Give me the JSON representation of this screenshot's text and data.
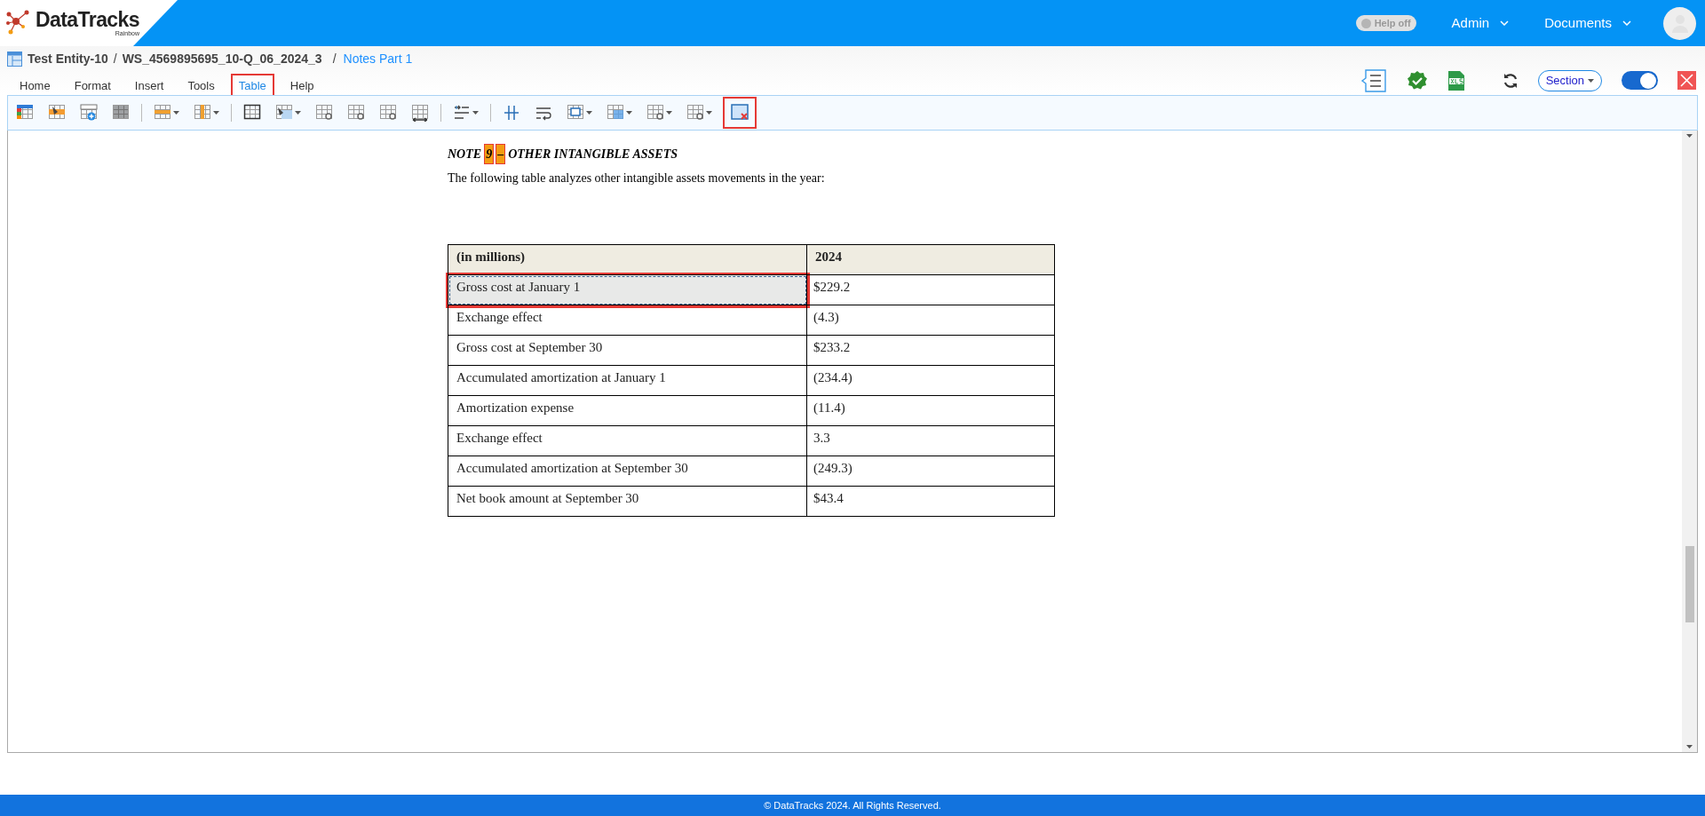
{
  "header": {
    "brand": "DataTracks",
    "brand_sub": "Rainbow",
    "help_toggle": {
      "label": "Help off",
      "on": false
    },
    "menus": [
      {
        "label": "Admin"
      },
      {
        "label": "Documents"
      }
    ]
  },
  "breadcrumb": {
    "entity": "Test Entity-10",
    "separator_1": "/",
    "workspace": "WS_4569895695_10-Q_06_2024_3",
    "separator_2": "/",
    "section": "Notes Part 1"
  },
  "tabs": [
    {
      "label": "Home",
      "selected": false,
      "marked": false
    },
    {
      "label": "Format",
      "selected": false,
      "marked": false
    },
    {
      "label": "Insert",
      "selected": false,
      "marked": false
    },
    {
      "label": "Tools",
      "selected": false,
      "marked": false
    },
    {
      "label": "Table",
      "selected": true,
      "marked": true
    },
    {
      "label": "Help",
      "selected": false,
      "marked": false
    }
  ],
  "right_tools": {
    "section_dropdown": "Section",
    "edit_toggle": {
      "on": true
    }
  },
  "toolbar": [
    {
      "kind": "color-grid",
      "dropdown": false,
      "marked": false
    },
    {
      "kind": "fill-grid",
      "dropdown": false,
      "marked": false
    },
    {
      "kind": "add",
      "dropdown": false,
      "marked": false
    },
    {
      "kind": "dots",
      "dropdown": false,
      "marked": false
    },
    {
      "kind": "separator"
    },
    {
      "kind": "row",
      "dropdown": true,
      "marked": false
    },
    {
      "kind": "column",
      "dropdown": true,
      "marked": false
    },
    {
      "kind": "separator"
    },
    {
      "kind": "borders",
      "dropdown": false,
      "marked": false
    },
    {
      "kind": "shade",
      "dropdown": true,
      "marked": false
    },
    {
      "kind": "gear",
      "dropdown": false,
      "marked": false
    },
    {
      "kind": "gear",
      "dropdown": false,
      "marked": false
    },
    {
      "kind": "gear",
      "dropdown": false,
      "marked": false
    },
    {
      "kind": "resize",
      "dropdown": false,
      "marked": false
    },
    {
      "kind": "separator"
    },
    {
      "kind": "indent",
      "dropdown": true,
      "marked": false
    },
    {
      "kind": "separator"
    },
    {
      "kind": "split",
      "dropdown": false,
      "marked": false
    },
    {
      "kind": "wrap",
      "dropdown": false,
      "marked": false
    },
    {
      "kind": "merge",
      "dropdown": true,
      "marked": false
    },
    {
      "kind": "blue-grid",
      "dropdown": true,
      "marked": false
    },
    {
      "kind": "gear",
      "dropdown": true,
      "marked": false
    },
    {
      "kind": "gear",
      "dropdown": true,
      "marked": false
    },
    {
      "kind": "delete",
      "dropdown": false,
      "marked": true
    }
  ],
  "note": {
    "prefix": "NOTE",
    "number": "9",
    "dash": "–",
    "title": "OTHER INTANGIBLE ASSETS",
    "intro": "The following table analyzes other intangible assets movements in the year:"
  },
  "table": {
    "columns": [
      "(in millions)",
      "2024"
    ],
    "rows": [
      {
        "cells": [
          "Gross cost at January 1",
          "$229.2"
        ],
        "selected": true,
        "marked": true
      },
      {
        "cells": [
          "Exchange effect",
          "(4.3)"
        ],
        "selected": false,
        "marked": false
      },
      {
        "cells": [
          "Gross cost at September 30",
          "$233.2"
        ],
        "selected": false,
        "marked": false
      },
      {
        "cells": [
          "Accumulated amortization at January 1",
          "(234.4)"
        ],
        "selected": false,
        "marked": false
      },
      {
        "cells": [
          "Amortization expense",
          "(11.4)"
        ],
        "selected": false,
        "marked": false
      },
      {
        "cells": [
          "Exchange effect",
          "3.3"
        ],
        "selected": false,
        "marked": false
      },
      {
        "cells": [
          "Accumulated amortization at September 30",
          "(249.3)"
        ],
        "selected": false,
        "marked": false
      },
      {
        "cells": [
          "Net book amount at September 30",
          "$43.4"
        ],
        "selected": false,
        "marked": false
      }
    ]
  },
  "footer": "© DataTracks 2024. All Rights Reserved."
}
